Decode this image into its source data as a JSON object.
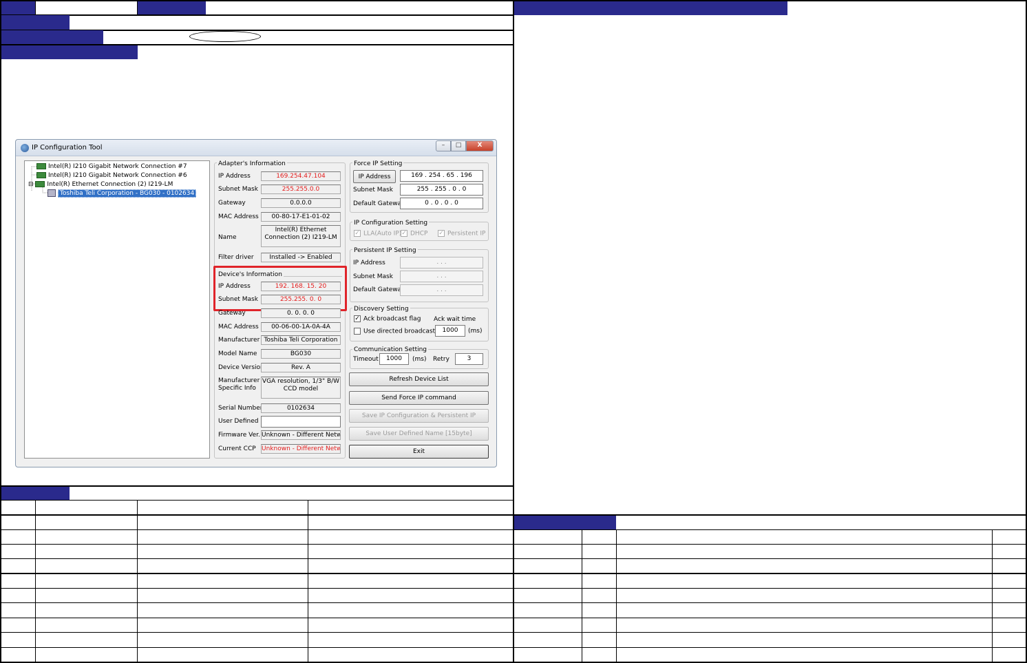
{
  "window": {
    "title": "IP Configuration Tool",
    "controls": {
      "minimize": "–",
      "maximize": "□",
      "close": "X"
    }
  },
  "tree": {
    "items": [
      {
        "label": "Intel(R) I210 Gigabit Network Connection #7",
        "icon": "network-adapter-icon"
      },
      {
        "label": "Intel(R) I210 Gigabit Network Connection #6",
        "icon": "network-adapter-icon"
      },
      {
        "label": "Intel(R) Ethernet Connection (2) I219-LM",
        "icon": "network-adapter-icon",
        "expander": "⊟"
      },
      {
        "label": "Toshiba Teli Corporation - BG030 - 0102634",
        "icon": "camera-device-icon",
        "selected": true
      }
    ]
  },
  "adapter": {
    "legend": "Adapter's Information",
    "ip_label": "IP Address",
    "ip": "169.254.47.104",
    "mask_label": "Subnet Mask",
    "mask": "255.255.0.0",
    "gateway_label": "Gateway",
    "gateway": "0.0.0.0",
    "mac_label": "MAC Address",
    "mac": "00-80-17-E1-01-02",
    "name_label": "Name",
    "name": "Intel(R) Ethernet Connection (2) I219-LM",
    "filter_label": "Filter driver",
    "filter": "Installed -> Enabled"
  },
  "device": {
    "legend": "Device's Information",
    "ip_label": "IP Address",
    "ip": "192. 168.  15.  20",
    "mask_label": "Subnet Mask",
    "mask": "255.255.  0.  0",
    "gateway_label": "Gateway",
    "gateway": "0.  0.  0.  0",
    "mac_label": "MAC Address",
    "mac": "00-06-00-1A-0A-4A",
    "manufacturer_label": "Manufacturer",
    "manufacturer": "Toshiba Teli Corporation",
    "model_label": "Model Name",
    "model": "BG030",
    "version_label": "Device Version",
    "version": "Rev. A",
    "specific_label_1": "Manufacturer",
    "specific_label_2": "Specific Info",
    "specific": "VGA resolution, 1/3\" B/W CCD model",
    "serial_label": "Serial Number",
    "serial": "0102634",
    "user_label": "User Defined",
    "user": "",
    "firmware_label": "Firmware Ver.",
    "firmware": "Unknown - Different Network",
    "ccp_label": "Current CCP",
    "ccp": "Unknown - Different Network"
  },
  "force_ip": {
    "legend": "Force IP Setting",
    "ip_button": "IP Address",
    "ip": [
      "169",
      "254",
      "65",
      "196"
    ],
    "mask_label": "Subnet Mask",
    "mask": [
      "255",
      "255",
      "0",
      "0"
    ],
    "gateway_label": "Default Gateway",
    "gateway": [
      "0",
      "0",
      "0",
      "0"
    ]
  },
  "ip_config": {
    "legend": "IP Configuration Setting",
    "lla": "LLA(Auto IP)",
    "dhcp": "DHCP",
    "persistent": "Persistent IP"
  },
  "persistent_ip": {
    "legend": "Persistent IP Setting",
    "ip_label": "IP Address",
    "mask_label": "Subnet Mask",
    "gateway_label": "Default Gateway",
    "placeholder": ".        .        ."
  },
  "discovery": {
    "legend": "Discovery Setting",
    "ack_flag": "Ack broadcast flag",
    "ack_wait_label": "Ack wait time",
    "directed": "Use directed broadcast",
    "ack_wait": "1000",
    "unit": "(ms)"
  },
  "communication": {
    "legend": "Communication Setting",
    "timeout_label": "Timeout",
    "timeout": "1000",
    "unit": "(ms)",
    "retry_label": "Retry",
    "retry": "3"
  },
  "buttons": {
    "refresh": "Refresh Device List",
    "send_force": "Send Force IP command",
    "save_ip": "Save IP Configuration & Persistent IP",
    "save_user": "Save User Defined Name [15byte]",
    "exit": "Exit"
  },
  "check": "✓",
  "colors": {
    "header_navy": "#2a2a8c",
    "value_red": "#e31c1c",
    "highlight_box": "#e0242a"
  }
}
